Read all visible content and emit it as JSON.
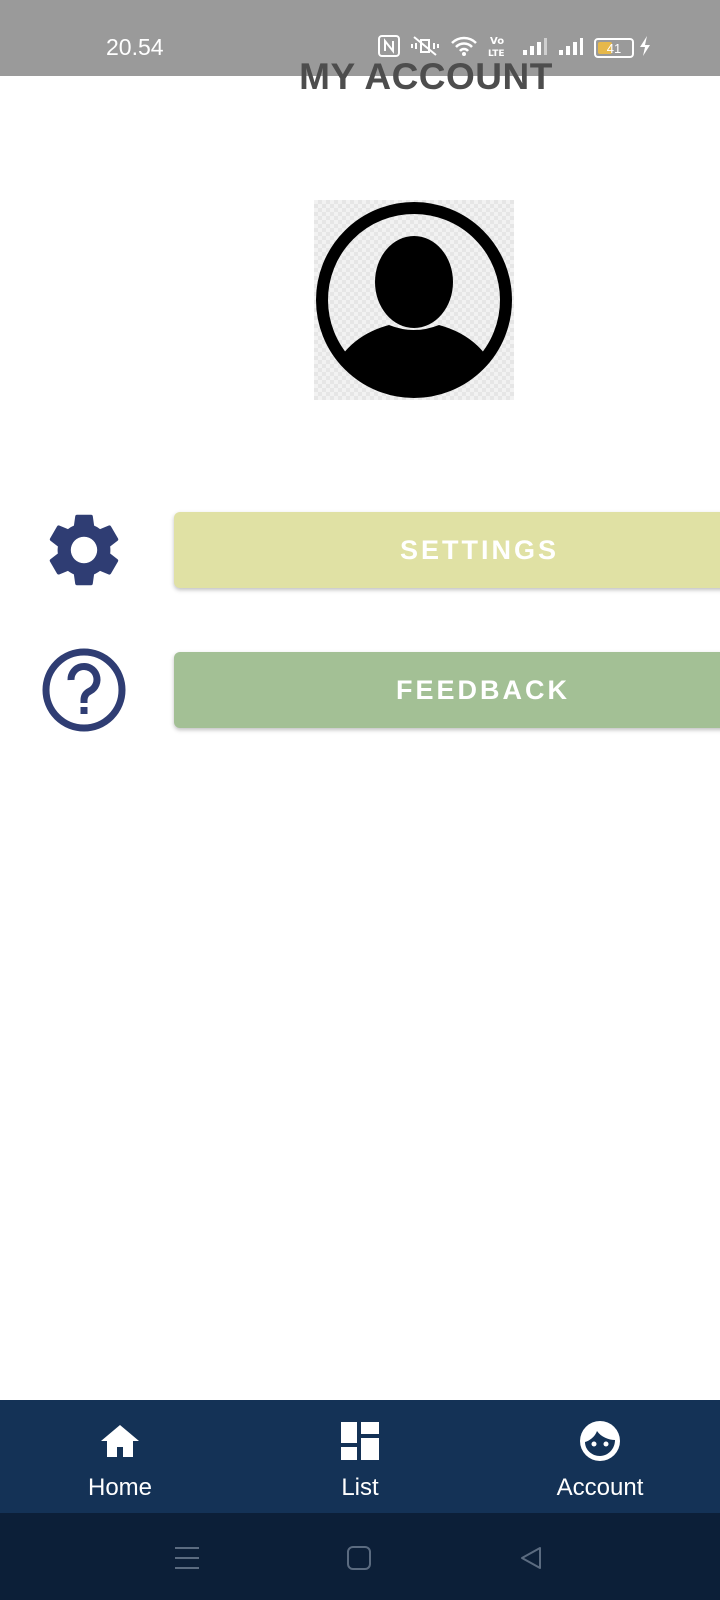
{
  "status_bar": {
    "time": "20.54",
    "battery_level": "41",
    "icons": [
      "nfc-icon",
      "vibrate-icon",
      "wifi-icon",
      "volte-icon",
      "signal-icon",
      "signal-icon",
      "battery-icon",
      "charging-icon"
    ]
  },
  "page": {
    "title": "MY ACCOUNT"
  },
  "actions": {
    "settings_label": "SETTINGS",
    "feedback_label": "FEEDBACK"
  },
  "bottom_nav": {
    "items": [
      {
        "label": "Home",
        "icon": "home-icon"
      },
      {
        "label": "List",
        "icon": "dashboard-icon"
      },
      {
        "label": "Account",
        "icon": "face-icon"
      }
    ]
  },
  "colors": {
    "settings_button": "#e0e1a4",
    "feedback_button": "#a3c095",
    "icon_color": "#2f3d73",
    "bottom_nav": "#143256",
    "system_bar": "#0c1f38",
    "status_bar": "#9a9a9a"
  }
}
